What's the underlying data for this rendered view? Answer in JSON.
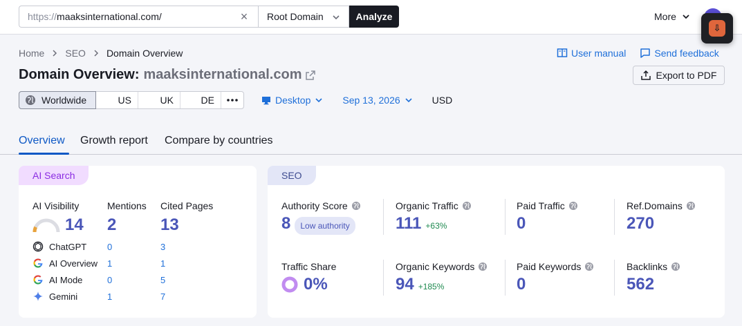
{
  "search": {
    "url_proto": "https://",
    "url_domain": "maaksinternational.com/",
    "scope": "Root Domain",
    "analyze_label": "Analyze"
  },
  "topbar": {
    "more_label": "More"
  },
  "breadcrumb": {
    "home": "Home",
    "seo": "SEO",
    "current": "Domain Overview"
  },
  "header": {
    "title_prefix": "Domain Overview:",
    "title_domain": "maaksinternational.com",
    "user_manual": "User manual",
    "send_feedback": "Send feedback",
    "export_label": "Export to PDF"
  },
  "regions": [
    "Worldwide",
    "US",
    "UK",
    "DE"
  ],
  "filters": {
    "device": "Desktop",
    "date": "Sep 13, 2026",
    "currency": "USD"
  },
  "tabs": [
    "Overview",
    "Growth report",
    "Compare by countries"
  ],
  "ai_card": {
    "tag": "AI Search",
    "visibility_label": "AI Visibility",
    "visibility_value": "14",
    "visibility_level": 0.14,
    "mentions_label": "Mentions",
    "mentions_value": "2",
    "cited_label": "Cited Pages",
    "cited_value": "13",
    "engines": [
      {
        "name": "ChatGPT",
        "mentions": "0",
        "cited": "3",
        "icon": "chatgpt-icon"
      },
      {
        "name": "AI Overview",
        "mentions": "1",
        "cited": "1",
        "icon": "google-icon"
      },
      {
        "name": "AI Mode",
        "mentions": "0",
        "cited": "5",
        "icon": "google-icon"
      },
      {
        "name": "Gemini",
        "mentions": "1",
        "cited": "7",
        "icon": "gemini-icon"
      }
    ]
  },
  "seo_card": {
    "tag": "SEO",
    "authority": {
      "label": "Authority Score",
      "value": "8",
      "badge": "Low authority"
    },
    "organic_traffic": {
      "label": "Organic Traffic",
      "value": "111",
      "change": "+63%"
    },
    "paid_traffic": {
      "label": "Paid Traffic",
      "value": "0"
    },
    "ref_domains": {
      "label": "Ref.Domains",
      "value": "270"
    },
    "traffic_share": {
      "label": "Traffic Share",
      "value": "0%"
    },
    "organic_keywords": {
      "label": "Organic Keywords",
      "value": "94",
      "change": "+185%"
    },
    "paid_keywords": {
      "label": "Paid Keywords",
      "value": "0"
    },
    "backlinks": {
      "label": "Backlinks",
      "value": "562"
    }
  },
  "colors": {
    "accent": "#4a56b8",
    "link": "#1e6fd9",
    "ai_tag": "#f1dcff",
    "seo_tag": "#e3e6f7",
    "positive": "#1f8a50"
  }
}
